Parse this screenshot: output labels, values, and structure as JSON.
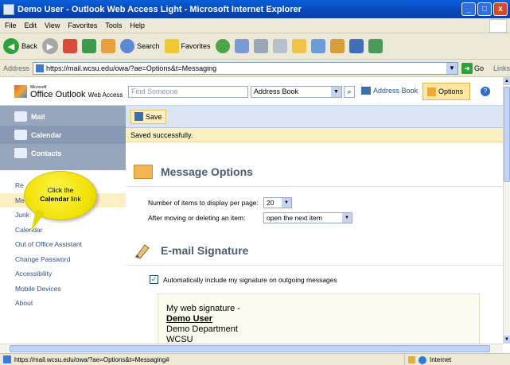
{
  "window": {
    "title": "Demo User - Outlook Web Access Light - Microsoft Internet Explorer",
    "btn_min": "_",
    "btn_max": "□",
    "btn_close": "x"
  },
  "menu": [
    "File",
    "Edit",
    "View",
    "Favorites",
    "Tools",
    "Help"
  ],
  "toolbar": {
    "back": "Back",
    "search": "Search",
    "favorites": "Favorites"
  },
  "address": {
    "label": "Address",
    "url": "https://mail.wcsu.edu/owa/?ae=Options&t=Messaging",
    "go": "Go",
    "links": "Links"
  },
  "owa": {
    "logo_small": "Microsoft",
    "logo_text": "Office Outlook",
    "logo_sub": "Web Access",
    "find_placeholder": "Find Someone",
    "address_book_select": "Address Book",
    "address_book_link": "Address Book",
    "options": "Options",
    "help": "?"
  },
  "nav": {
    "buttons": [
      "Mail",
      "Calendar",
      "Contacts"
    ],
    "options": [
      "Re",
      "Me",
      "Junk",
      "Calendar",
      "Out of Office Assistant",
      "Change Password",
      "Accessibility",
      "Mobile Devices",
      "About"
    ]
  },
  "callout": {
    "line1": "Click the",
    "bold": "Calendar",
    "rest": " link"
  },
  "main": {
    "save": "Save",
    "saved_msg": "Saved successfully.",
    "msg_options_title": "Message Options",
    "items_label": "Number of items to display per page:",
    "items_value": "20",
    "after_label": "After moving or deleting an item:",
    "after_value": "open the next item",
    "signature_title": "E-mail Signature",
    "auto_sig_label": "Automatically include my signature on outgoing messages",
    "auto_sig_checked": true,
    "sig_line1": "My web signature -",
    "sig_name": "Demo User",
    "sig_dept": "Demo Department",
    "sig_org": "WCSU"
  },
  "status": {
    "url": "https://mail.wcsu.edu/owa/?ae=Options&t=Messaging#",
    "zone": "Internet"
  }
}
